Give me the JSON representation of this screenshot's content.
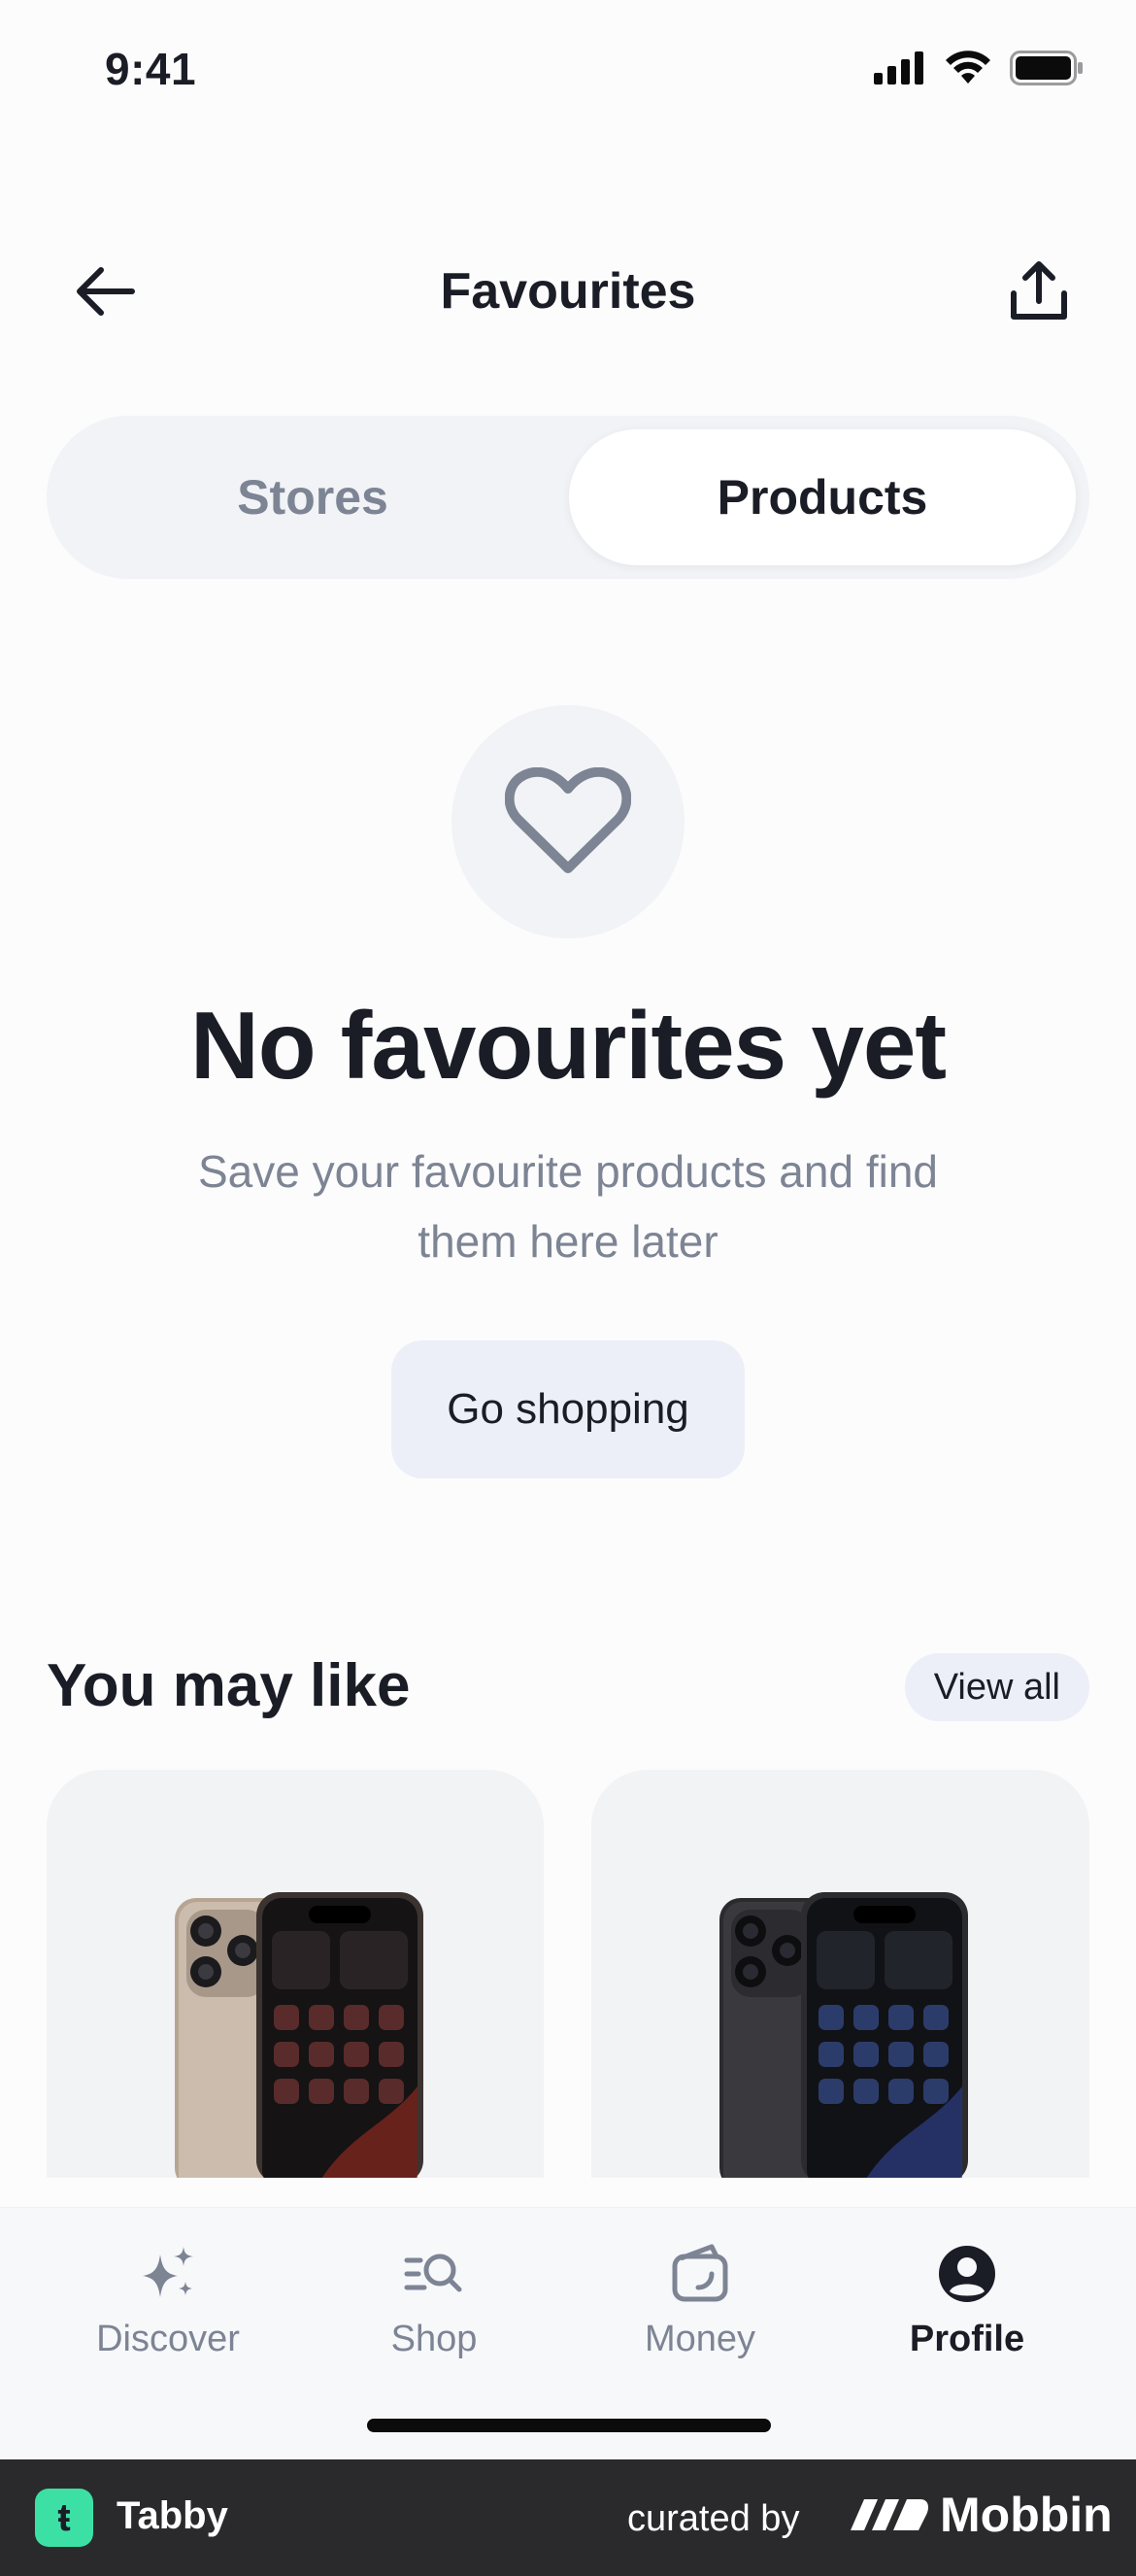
{
  "status_bar": {
    "time": "9:41"
  },
  "header": {
    "title": "Favourites"
  },
  "tabs": {
    "stores": "Stores",
    "products": "Products",
    "selected": "Products"
  },
  "empty_state": {
    "icon": "heart-icon",
    "title": "No favourites yet",
    "subtitle": "Save your favourite products and find them here later",
    "button": "Go shopping"
  },
  "recommendations": {
    "title": "You may like",
    "view_all": "View all",
    "products": [
      {
        "image": "phone-natural-titanium"
      },
      {
        "image": "phone-black-titanium"
      }
    ]
  },
  "tab_bar": {
    "items": [
      {
        "label": "Discover",
        "icon": "sparkles-icon",
        "active": false
      },
      {
        "label": "Shop",
        "icon": "shop-search-icon",
        "active": false
      },
      {
        "label": "Money",
        "icon": "wallet-icon",
        "active": false
      },
      {
        "label": "Profile",
        "icon": "profile-icon",
        "active": true
      }
    ]
  },
  "footer": {
    "app_name": "Tabby",
    "curated_by": "curated by",
    "brand": "Mobbin"
  },
  "colors": {
    "accent": "#3de0a4",
    "muted": "#7d8494",
    "text": "#1b1d26",
    "chip": "#eceff7"
  }
}
